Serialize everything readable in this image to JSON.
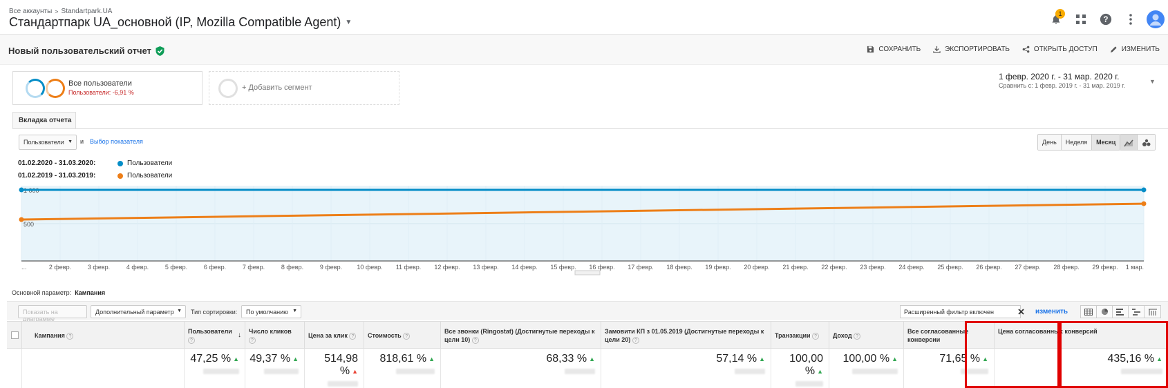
{
  "header": {
    "breadcrumb": [
      "Все аккаунты",
      "Standartpark.UA"
    ],
    "account_title": "Стандартпарк UA_основной (IP, Mozilla Compatible Agent)",
    "notifications_count": "1"
  },
  "report": {
    "title": "Новый пользовательский отчет",
    "actions": [
      "СОХРАНИТЬ",
      "ЭКСПОРТИРОВАТЬ",
      "ОТКРЫТЬ ДОСТУП",
      "ИЗМЕНИТЬ"
    ]
  },
  "segment": {
    "name": "Все пользователи",
    "sub": "Пользователи: -6,91 %",
    "add_label": "+ Добавить сегмент"
  },
  "date": {
    "range": "1 февр. 2020 г. - 31 мар. 2020 г.",
    "compare": "Сравнить с: 1 февр. 2019 г. - 31 мар. 2019 г."
  },
  "tab_label": "Вкладка отчета",
  "chart_controls": {
    "metric": "Пользователи",
    "and": "и",
    "choose_metric": "Выбор показателя",
    "periods": [
      "День",
      "Неделя",
      "Месяц"
    ],
    "active_period": "Месяц"
  },
  "legend": [
    {
      "period": "01.02.2020 - 31.03.2020:",
      "label": "Пользователи",
      "color": "#058dc7"
    },
    {
      "period": "01.02.2019 - 31.03.2019:",
      "label": "Пользователи",
      "color": "#ed7e17"
    }
  ],
  "chart_data": {
    "type": "line",
    "x": [
      "...",
      "2 февр.",
      "3 февр.",
      "4 февр.",
      "5 февр.",
      "6 февр.",
      "7 февр.",
      "8 февр.",
      "9 февр.",
      "10 февр.",
      "11 февр.",
      "12 февр.",
      "13 февр.",
      "14 февр.",
      "15 февр.",
      "16 февр.",
      "17 февр.",
      "18 февр.",
      "19 февр.",
      "20 февр.",
      "21 февр.",
      "22 февр.",
      "23 февр.",
      "24 февр.",
      "25 февр.",
      "26 февр.",
      "27 февр.",
      "28 февр.",
      "29 февр.",
      "1 мар."
    ],
    "y_ticks": [
      "1 000",
      "500"
    ],
    "ylim": [
      0,
      1000
    ],
    "series": [
      {
        "name": "Пользователи",
        "period": "01.02.2020 - 31.03.2020",
        "color": "#058dc7",
        "start": 1000,
        "end": 1000
      },
      {
        "name": "Пользователи",
        "period": "01.02.2019 - 31.03.2019",
        "color": "#ed7e17",
        "start": 560,
        "end": 795
      }
    ]
  },
  "table": {
    "primary_dimension_label": "Основной параметр:",
    "primary_dimension_value": "Кампания",
    "show_on_chart": "Показать на диаграмме",
    "secondary_param": "Дополнительный параметр",
    "sort_type_label": "Тип сортировки:",
    "sort_type_value": "По умолчанию",
    "filter_text": "Расширенный фильтр включен",
    "edit_link": "изменить",
    "columns": [
      {
        "label": "Кампания"
      },
      {
        "label": "Пользователи"
      },
      {
        "label": "Число кликов"
      },
      {
        "label": "Цена за клик"
      },
      {
        "label": "Стоимость"
      },
      {
        "label": "Все звонки (Ringostat) (Достигнутые переходы к цели 10)"
      },
      {
        "label": "Замовити КП з 01.05.2019 (Достигнутые переходы к цели 20)"
      },
      {
        "label": "Транзакции"
      },
      {
        "label": "Доход"
      },
      {
        "label": "Все согласованные конверсии"
      },
      {
        "label": "Цена согласованных конверсий"
      }
    ],
    "totals": [
      "47,25 %",
      "49,37 %",
      "514,98 %",
      "818,61 %",
      "68,33 %",
      "57,14 %",
      "100,00 %",
      "100,00 %",
      "71,65 %",
      "435,16 %"
    ],
    "trends": [
      "up",
      "up",
      "down",
      "up",
      "up",
      "up",
      "up",
      "up",
      "up",
      "up"
    ]
  }
}
